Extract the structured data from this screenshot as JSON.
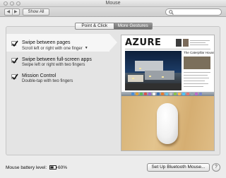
{
  "window": {
    "title": "Mouse"
  },
  "toolbar": {
    "back_glyph": "◀",
    "forward_glyph": "▶",
    "show_all_label": "Show All",
    "search_value": "",
    "search_icon": "magnifier-icon"
  },
  "tabs": [
    {
      "label": "Point & Click",
      "selected": false
    },
    {
      "label": "More Gestures",
      "selected": true
    }
  ],
  "options": [
    {
      "title": "Swipe between pages",
      "description": "Scroll left or right with one finger",
      "checked": true,
      "selected": true,
      "has_menu": true
    },
    {
      "title": "Swipe between full-screen apps",
      "description": "Swipe left or right with two fingers",
      "checked": true,
      "selected": false,
      "has_menu": false
    },
    {
      "title": "Mission Control",
      "description": "Double-tap with two fingers",
      "checked": true,
      "selected": false,
      "has_menu": false
    }
  ],
  "preview": {
    "logo_text": "AZURE",
    "side_headline": "The Caterpillar House"
  },
  "footer": {
    "battery_label": "Mouse battery level:",
    "battery_value": "60%",
    "battery_fraction": 0.6,
    "setup_button_label": "Set Up Bluetooth Mouse...",
    "help_label": "?"
  },
  "colors": {
    "selected_tab": "#7a7a7a",
    "row_highlight": "#f6f6f6",
    "desk_wood": "#dcb97f"
  }
}
